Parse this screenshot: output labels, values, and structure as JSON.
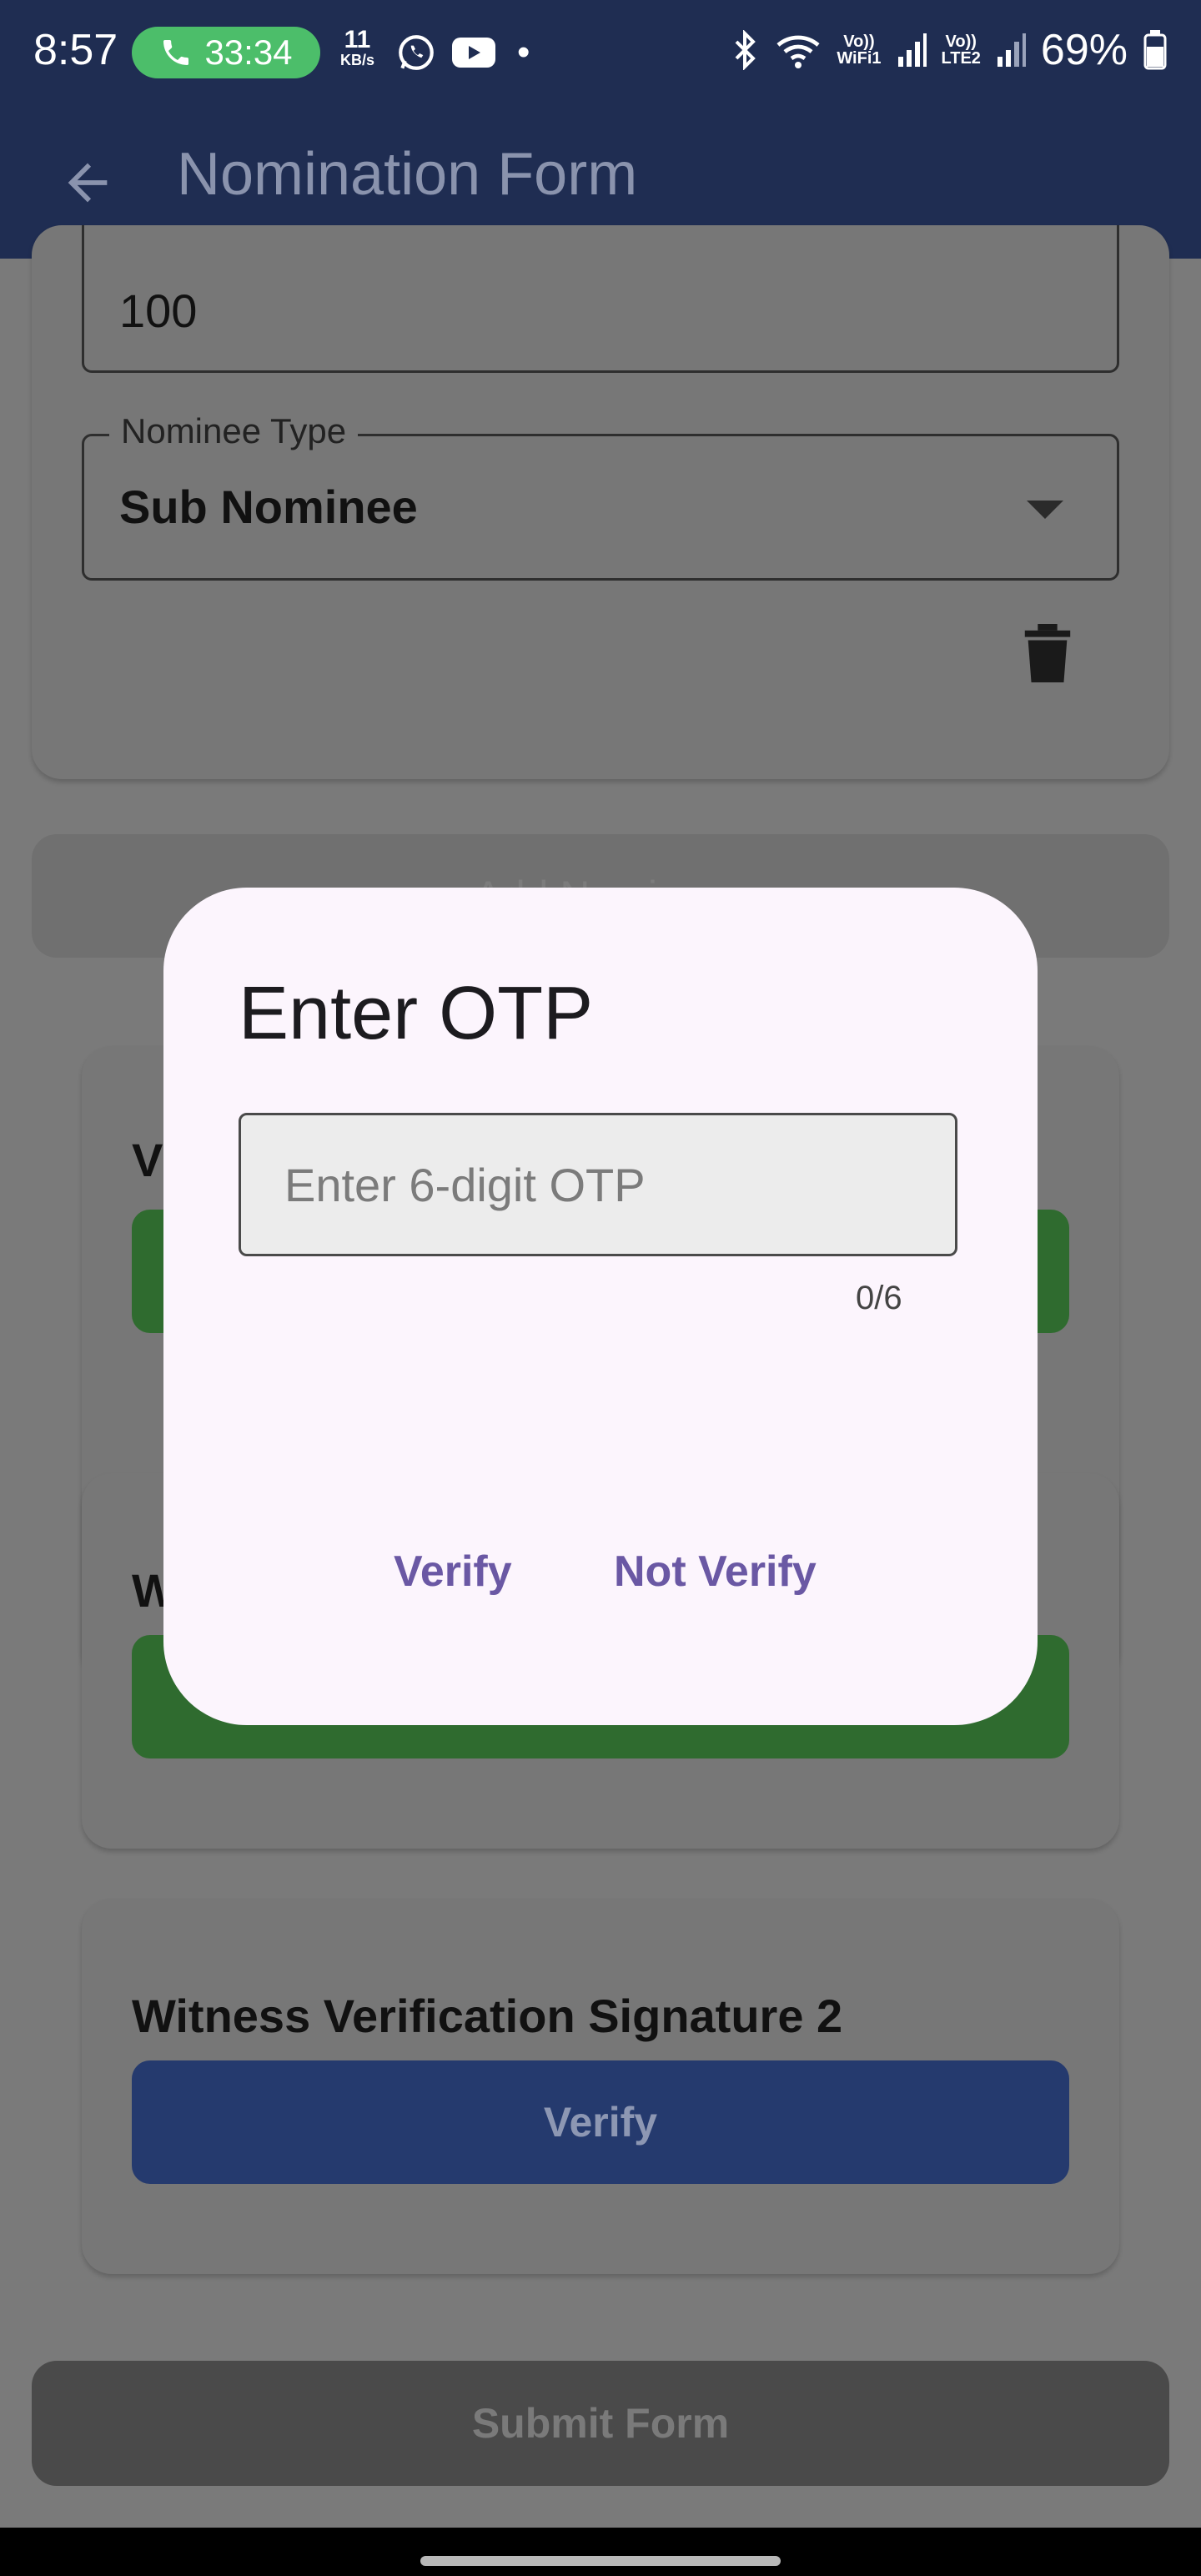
{
  "status_bar": {
    "time": "8:57",
    "call_timer": "33:34",
    "net_speed_value": "11",
    "net_speed_unit": "KB/s",
    "dot": "•",
    "wifi_label_top": "Vo))",
    "wifi_label_bottom": "WiFi1",
    "lte_label_top": "Vo))",
    "lte_label_bottom": "LTE2",
    "battery": "69%"
  },
  "app_bar": {
    "title": "Nomination Form"
  },
  "form": {
    "share_value": "100",
    "nominee_type_label": "Nominee Type",
    "nominee_type_value": "Sub Nominee",
    "add_button_label": "Add Nominee",
    "partial_card1_title": "V",
    "partial_card2_title": "W",
    "witness2_title": "Witness Verification Signature 2",
    "witness2_button": "Verify",
    "submit_button": "Submit Form"
  },
  "dialog": {
    "title": "Enter OTP",
    "placeholder": "Enter 6-digit OTP",
    "counter": "0/6",
    "verify_label": "Verify",
    "not_verify_label": "Not Verify"
  },
  "colors": {
    "primary_navy": "#1f2d52",
    "green_button": "#2f6b2f",
    "blue_button": "#253a6e",
    "dialog_bg": "#fcf5fd",
    "dialog_action": "#6a58a4",
    "call_pill": "#4cbe6a"
  }
}
